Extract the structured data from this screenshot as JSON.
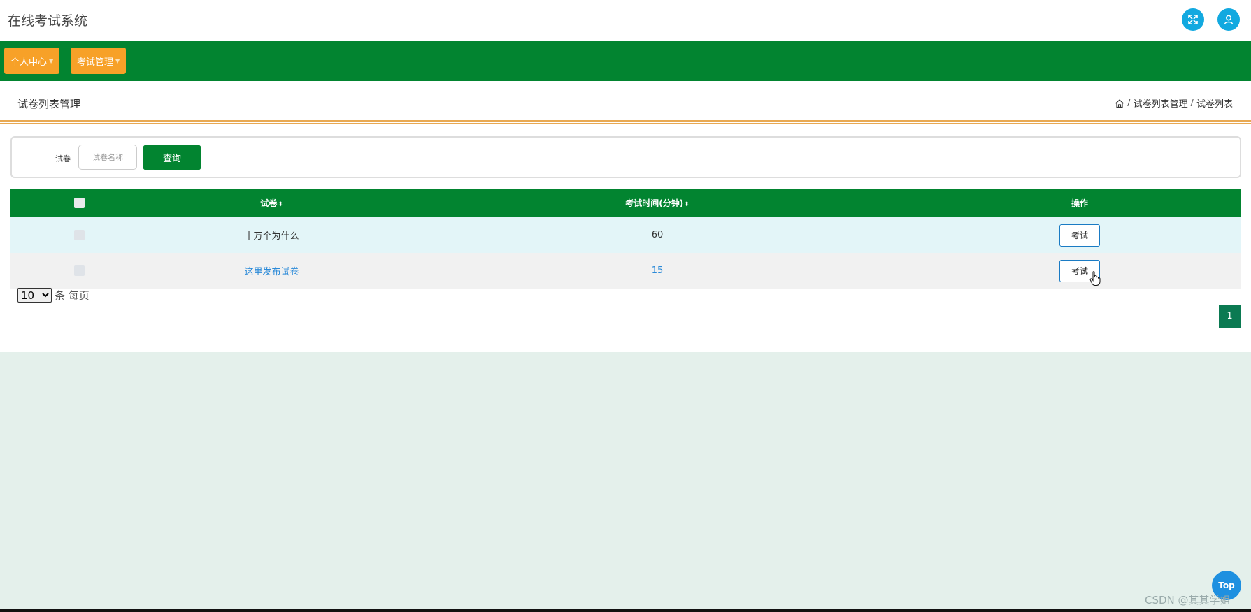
{
  "app": {
    "title": "在线考试系统"
  },
  "header_icons": {
    "fullscreen": "expand-icon",
    "user": "user-icon",
    "color": "#12a9e0"
  },
  "nav": {
    "items": [
      {
        "label": "个人中心"
      },
      {
        "label": "考试管理"
      }
    ],
    "bg_color": "#028430",
    "item_color": "#f7a128"
  },
  "page": {
    "title": "试卷列表管理",
    "breadcrumb": [
      "试卷列表管理",
      "试卷列表"
    ]
  },
  "search": {
    "label": "试卷",
    "placeholder": "试卷名称",
    "button_label": "查询"
  },
  "table": {
    "columns": [
      "试卷",
      "考试时间(分钟)",
      "操作"
    ],
    "sort_icon": "⬍",
    "rows": [
      {
        "name": "十万个为什么",
        "time": "60",
        "action": "考试"
      },
      {
        "name": "这里发布试卷",
        "time": "15",
        "action": "考试"
      }
    ]
  },
  "pager": {
    "page_size": "10",
    "page_size_options": [
      "10"
    ],
    "per_page_label": "条 每页",
    "current_page": "1"
  },
  "top_button": {
    "label": "Top"
  },
  "watermark": "CSDN @其其学姐"
}
